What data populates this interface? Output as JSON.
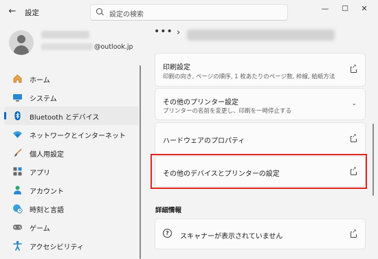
{
  "window": {
    "title": "設定",
    "back_icon": "arrow-left-icon",
    "controls": [
      "minimize",
      "maximize",
      "close"
    ]
  },
  "search": {
    "placeholder": "設定の検索"
  },
  "profile": {
    "email_domain": "@outlook.jp"
  },
  "nav": {
    "items": [
      {
        "label": "ホーム",
        "icon": "home-icon"
      },
      {
        "label": "システム",
        "icon": "monitor-icon"
      },
      {
        "label": "Bluetooth とデバイス",
        "icon": "bluetooth-icon",
        "selected": true
      },
      {
        "label": "ネットワークとインターネット",
        "icon": "wifi-icon"
      },
      {
        "label": "個人用設定",
        "icon": "brush-icon"
      },
      {
        "label": "アプリ",
        "icon": "apps-icon"
      },
      {
        "label": "アカウント",
        "icon": "person-icon"
      },
      {
        "label": "時刻と言語",
        "icon": "globe-clock-icon"
      },
      {
        "label": "ゲーム",
        "icon": "gamepad-icon"
      },
      {
        "label": "アクセシビリティ",
        "icon": "accessibility-icon"
      }
    ]
  },
  "breadcrumb": {
    "more": "•••",
    "separator": "›"
  },
  "settings": {
    "print_settings": {
      "title": "印刷設定",
      "description": "印刷の向き, ページの順序, 1 枚あたりのページ数, 枠線, 給紙方法"
    },
    "other_printer_settings": {
      "title": "その他のプリンター設定",
      "description": "プリンターの名前を変更し、印刷を一時停止する"
    },
    "hardware_properties": {
      "title": "ハードウェアのプロパティ"
    },
    "other_devices_printers": {
      "title": "その他のデバイスとプリンターの設定"
    }
  },
  "details": {
    "heading": "詳細情報",
    "scanner_message": "スキャナーが表示されていません"
  },
  "colors": {
    "accent": "#0067c0",
    "highlight": "#e3241b"
  }
}
